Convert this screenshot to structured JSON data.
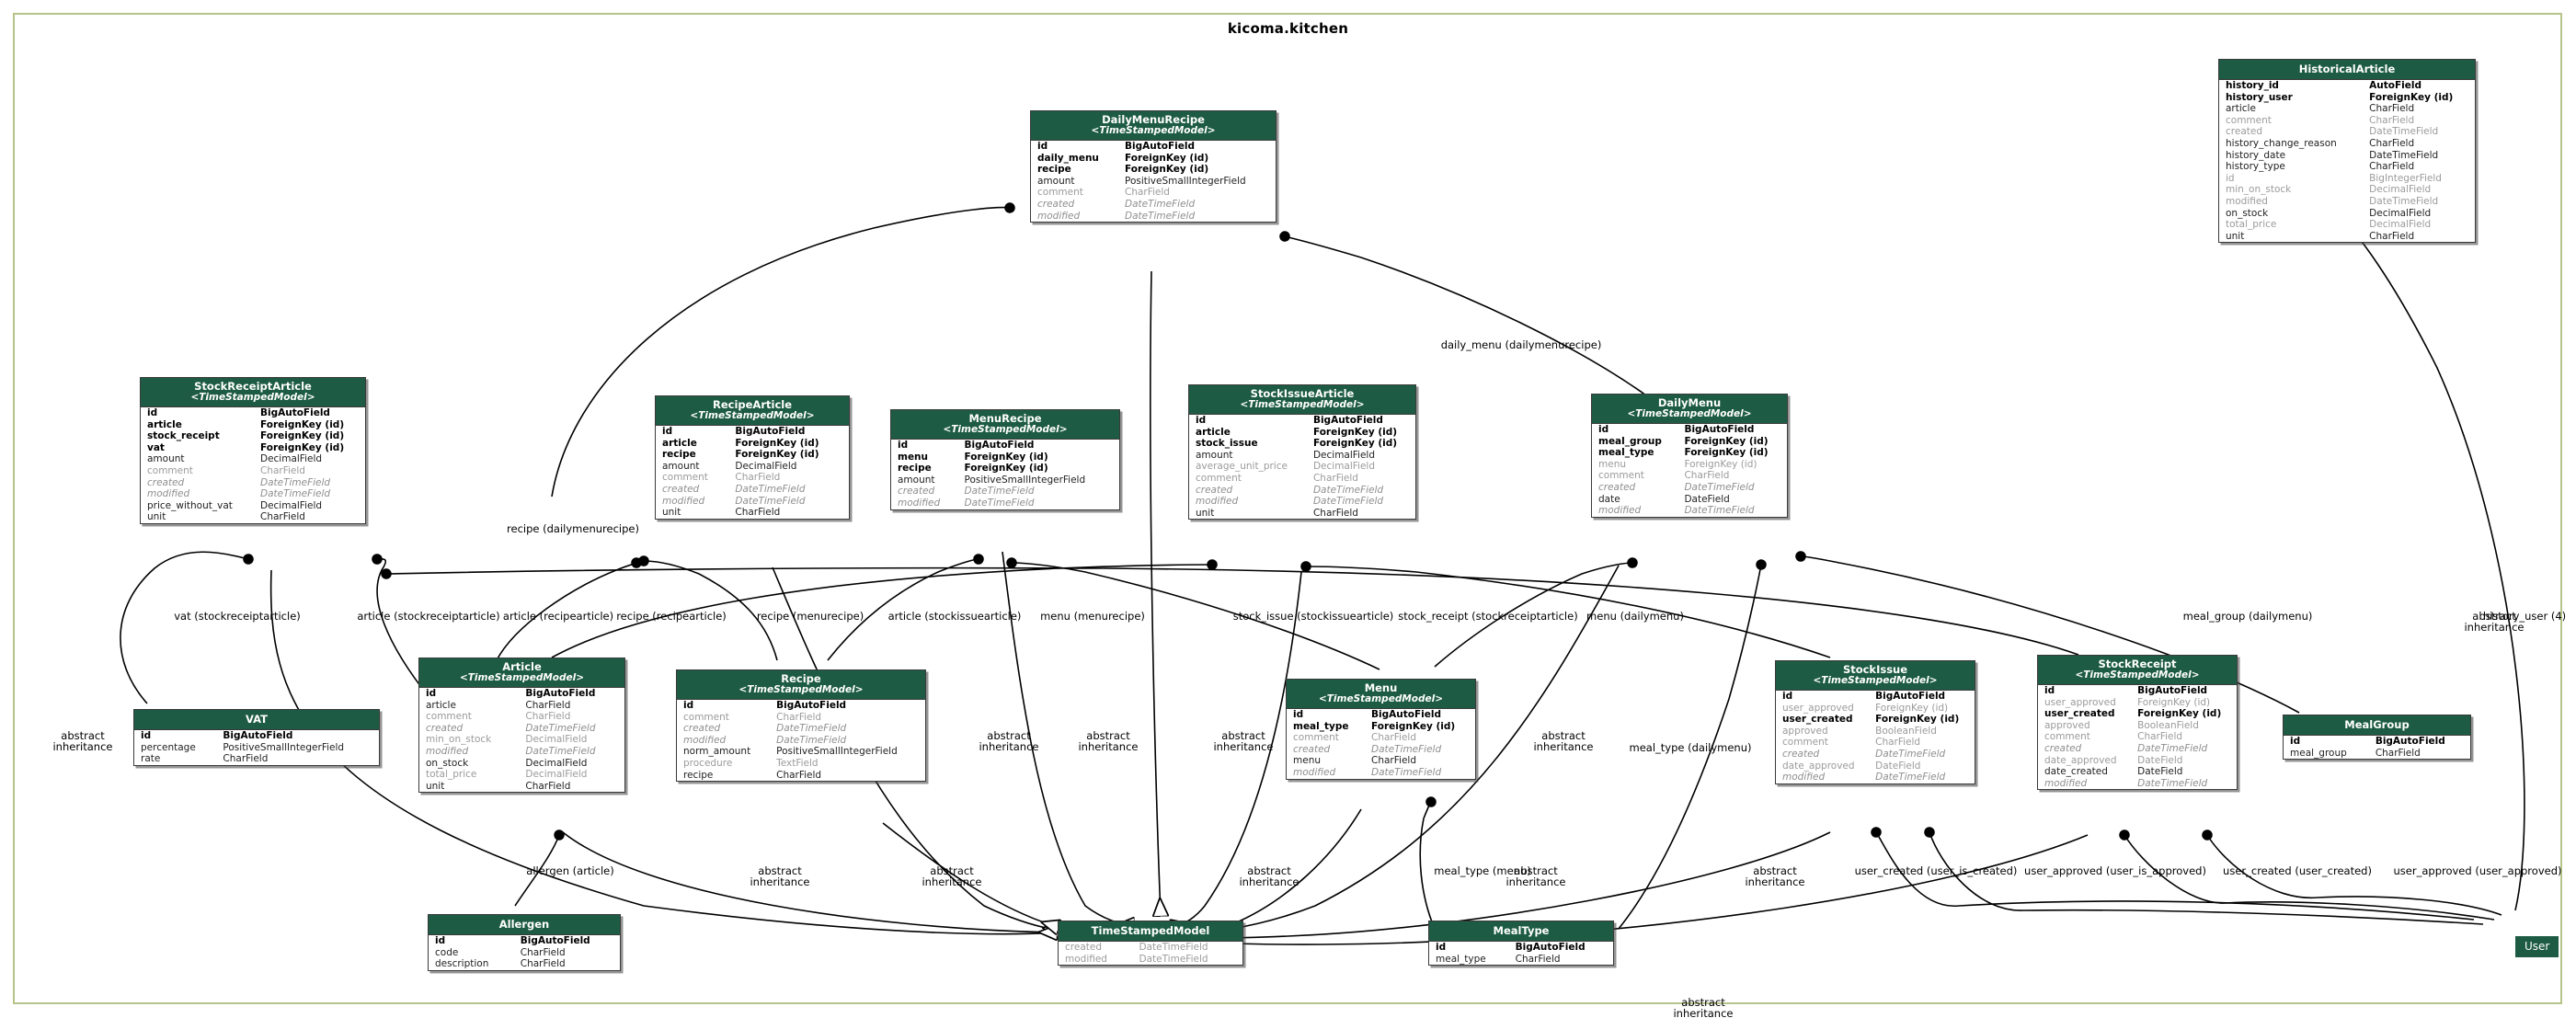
{
  "diagram": {
    "title": "kicoma.kitchen",
    "type": "django-model-erd",
    "header_color": "#1d5b44",
    "border_color": "#b6c48a",
    "edge_color": "#000000"
  },
  "models": [
    {
      "id": "historicalarticle",
      "name": "HistoricalArticle",
      "base": "",
      "fields": [
        {
          "name": "history_id",
          "type": "AutoField",
          "style": "rel"
        },
        {
          "name": "history_user",
          "type": "ForeignKey (id)",
          "style": "rel"
        },
        {
          "name": "article",
          "type": "CharField",
          "style": "plain"
        },
        {
          "name": "comment",
          "type": "CharField",
          "style": "dim"
        },
        {
          "name": "created",
          "type": "DateTimeField",
          "style": "dim"
        },
        {
          "name": "history_change_reason",
          "type": "CharField",
          "style": "plain"
        },
        {
          "name": "history_date",
          "type": "DateTimeField",
          "style": "plain"
        },
        {
          "name": "history_type",
          "type": "CharField",
          "style": "plain"
        },
        {
          "name": "id",
          "type": "BigIntegerField",
          "style": "dim"
        },
        {
          "name": "min_on_stock",
          "type": "DecimalField",
          "style": "dim"
        },
        {
          "name": "modified",
          "type": "DateTimeField",
          "style": "dim"
        },
        {
          "name": "on_stock",
          "type": "DecimalField",
          "style": "plain"
        },
        {
          "name": "total_price",
          "type": "DecimalField",
          "style": "dim"
        },
        {
          "name": "unit",
          "type": "CharField",
          "style": "plain"
        }
      ]
    },
    {
      "id": "dailymenurecipe",
      "name": "DailyMenuRecipe",
      "base": "<TimeStampedModel>",
      "fields": [
        {
          "name": "id",
          "type": "BigAutoField",
          "style": "rel"
        },
        {
          "name": "daily_menu",
          "type": "ForeignKey (id)",
          "style": "rel"
        },
        {
          "name": "recipe",
          "type": "ForeignKey (id)",
          "style": "rel"
        },
        {
          "name": "amount",
          "type": "PositiveSmallIntegerField",
          "style": "plain"
        },
        {
          "name": "comment",
          "type": "CharField",
          "style": "dim"
        },
        {
          "name": "created",
          "type": "DateTimeField",
          "style": "abs"
        },
        {
          "name": "modified",
          "type": "DateTimeField",
          "style": "abs"
        }
      ]
    },
    {
      "id": "stockreceiptarticle",
      "name": "StockReceiptArticle",
      "base": "<TimeStampedModel>",
      "fields": [
        {
          "name": "id",
          "type": "BigAutoField",
          "style": "rel"
        },
        {
          "name": "article",
          "type": "ForeignKey (id)",
          "style": "rel"
        },
        {
          "name": "stock_receipt",
          "type": "ForeignKey (id)",
          "style": "rel"
        },
        {
          "name": "vat",
          "type": "ForeignKey (id)",
          "style": "rel"
        },
        {
          "name": "amount",
          "type": "DecimalField",
          "style": "plain"
        },
        {
          "name": "comment",
          "type": "CharField",
          "style": "dim"
        },
        {
          "name": "created",
          "type": "DateTimeField",
          "style": "abs"
        },
        {
          "name": "modified",
          "type": "DateTimeField",
          "style": "abs"
        },
        {
          "name": "price_without_vat",
          "type": "DecimalField",
          "style": "plain"
        },
        {
          "name": "unit",
          "type": "CharField",
          "style": "plain"
        }
      ]
    },
    {
      "id": "recipearticle",
      "name": "RecipeArticle",
      "base": "<TimeStampedModel>",
      "fields": [
        {
          "name": "id",
          "type": "BigAutoField",
          "style": "rel"
        },
        {
          "name": "article",
          "type": "ForeignKey (id)",
          "style": "rel"
        },
        {
          "name": "recipe",
          "type": "ForeignKey (id)",
          "style": "rel"
        },
        {
          "name": "amount",
          "type": "DecimalField",
          "style": "plain"
        },
        {
          "name": "comment",
          "type": "CharField",
          "style": "dim"
        },
        {
          "name": "created",
          "type": "DateTimeField",
          "style": "abs"
        },
        {
          "name": "modified",
          "type": "DateTimeField",
          "style": "abs"
        },
        {
          "name": "unit",
          "type": "CharField",
          "style": "plain"
        }
      ]
    },
    {
      "id": "menurecipe",
      "name": "MenuRecipe",
      "base": "<TimeStampedModel>",
      "fields": [
        {
          "name": "id",
          "type": "BigAutoField",
          "style": "rel"
        },
        {
          "name": "menu",
          "type": "ForeignKey (id)",
          "style": "rel"
        },
        {
          "name": "recipe",
          "type": "ForeignKey (id)",
          "style": "rel"
        },
        {
          "name": "amount",
          "type": "PositiveSmallIntegerField",
          "style": "plain"
        },
        {
          "name": "created",
          "type": "DateTimeField",
          "style": "abs"
        },
        {
          "name": "modified",
          "type": "DateTimeField",
          "style": "abs"
        }
      ]
    },
    {
      "id": "stockissuearticle",
      "name": "StockIssueArticle",
      "base": "<TimeStampedModel>",
      "fields": [
        {
          "name": "id",
          "type": "BigAutoField",
          "style": "rel"
        },
        {
          "name": "article",
          "type": "ForeignKey (id)",
          "style": "rel"
        },
        {
          "name": "stock_issue",
          "type": "ForeignKey (id)",
          "style": "rel"
        },
        {
          "name": "amount",
          "type": "DecimalField",
          "style": "plain"
        },
        {
          "name": "average_unit_price",
          "type": "DecimalField",
          "style": "dim"
        },
        {
          "name": "comment",
          "type": "CharField",
          "style": "dim"
        },
        {
          "name": "created",
          "type": "DateTimeField",
          "style": "abs"
        },
        {
          "name": "modified",
          "type": "DateTimeField",
          "style": "abs"
        },
        {
          "name": "unit",
          "type": "CharField",
          "style": "plain"
        }
      ]
    },
    {
      "id": "dailymenu",
      "name": "DailyMenu",
      "base": "<TimeStampedModel>",
      "fields": [
        {
          "name": "id",
          "type": "BigAutoField",
          "style": "rel"
        },
        {
          "name": "meal_group",
          "type": "ForeignKey (id)",
          "style": "rel"
        },
        {
          "name": "meal_type",
          "type": "ForeignKey (id)",
          "style": "rel"
        },
        {
          "name": "menu",
          "type": "ForeignKey (id)",
          "style": "dim"
        },
        {
          "name": "comment",
          "type": "CharField",
          "style": "dim"
        },
        {
          "name": "created",
          "type": "DateTimeField",
          "style": "abs"
        },
        {
          "name": "date",
          "type": "DateField",
          "style": "plain"
        },
        {
          "name": "modified",
          "type": "DateTimeField",
          "style": "abs"
        }
      ]
    },
    {
      "id": "article",
      "name": "Article",
      "base": "<TimeStampedModel>",
      "fields": [
        {
          "name": "id",
          "type": "BigAutoField",
          "style": "rel"
        },
        {
          "name": "article",
          "type": "CharField",
          "style": "plain"
        },
        {
          "name": "comment",
          "type": "CharField",
          "style": "dim"
        },
        {
          "name": "created",
          "type": "DateTimeField",
          "style": "abs"
        },
        {
          "name": "min_on_stock",
          "type": "DecimalField",
          "style": "dim"
        },
        {
          "name": "modified",
          "type": "DateTimeField",
          "style": "abs"
        },
        {
          "name": "on_stock",
          "type": "DecimalField",
          "style": "plain"
        },
        {
          "name": "total_price",
          "type": "DecimalField",
          "style": "dim"
        },
        {
          "name": "unit",
          "type": "CharField",
          "style": "plain"
        }
      ]
    },
    {
      "id": "recipe",
      "name": "Recipe",
      "base": "<TimeStampedModel>",
      "fields": [
        {
          "name": "id",
          "type": "BigAutoField",
          "style": "rel"
        },
        {
          "name": "comment",
          "type": "CharField",
          "style": "dim"
        },
        {
          "name": "created",
          "type": "DateTimeField",
          "style": "abs"
        },
        {
          "name": "modified",
          "type": "DateTimeField",
          "style": "abs"
        },
        {
          "name": "norm_amount",
          "type": "PositiveSmallIntegerField",
          "style": "plain"
        },
        {
          "name": "procedure",
          "type": "TextField",
          "style": "dim"
        },
        {
          "name": "recipe",
          "type": "CharField",
          "style": "plain"
        }
      ]
    },
    {
      "id": "menu",
      "name": "Menu",
      "base": "<TimeStampedModel>",
      "fields": [
        {
          "name": "id",
          "type": "BigAutoField",
          "style": "rel"
        },
        {
          "name": "meal_type",
          "type": "ForeignKey (id)",
          "style": "rel"
        },
        {
          "name": "comment",
          "type": "CharField",
          "style": "dim"
        },
        {
          "name": "created",
          "type": "DateTimeField",
          "style": "abs"
        },
        {
          "name": "menu",
          "type": "CharField",
          "style": "plain"
        },
        {
          "name": "modified",
          "type": "DateTimeField",
          "style": "abs"
        }
      ]
    },
    {
      "id": "stockissue",
      "name": "StockIssue",
      "base": "<TimeStampedModel>",
      "fields": [
        {
          "name": "id",
          "type": "BigAutoField",
          "style": "rel"
        },
        {
          "name": "user_approved",
          "type": "ForeignKey (id)",
          "style": "dim"
        },
        {
          "name": "user_created",
          "type": "ForeignKey (id)",
          "style": "rel"
        },
        {
          "name": "approved",
          "type": "BooleanField",
          "style": "dim"
        },
        {
          "name": "comment",
          "type": "CharField",
          "style": "dim"
        },
        {
          "name": "created",
          "type": "DateTimeField",
          "style": "abs"
        },
        {
          "name": "date_approved",
          "type": "DateField",
          "style": "dim"
        },
        {
          "name": "modified",
          "type": "DateTimeField",
          "style": "abs"
        }
      ]
    },
    {
      "id": "stockreceipt",
      "name": "StockReceipt",
      "base": "<TimeStampedModel>",
      "fields": [
        {
          "name": "id",
          "type": "BigAutoField",
          "style": "rel"
        },
        {
          "name": "user_approved",
          "type": "ForeignKey (id)",
          "style": "dim"
        },
        {
          "name": "user_created",
          "type": "ForeignKey (id)",
          "style": "rel"
        },
        {
          "name": "approved",
          "type": "BooleanField",
          "style": "dim"
        },
        {
          "name": "comment",
          "type": "CharField",
          "style": "dim"
        },
        {
          "name": "created",
          "type": "DateTimeField",
          "style": "abs"
        },
        {
          "name": "date_approved",
          "type": "DateField",
          "style": "dim"
        },
        {
          "name": "date_created",
          "type": "DateField",
          "style": "plain"
        },
        {
          "name": "modified",
          "type": "DateTimeField",
          "style": "abs"
        }
      ]
    },
    {
      "id": "vat",
      "name": "VAT",
      "base": "",
      "fields": [
        {
          "name": "id",
          "type": "BigAutoField",
          "style": "rel"
        },
        {
          "name": "percentage",
          "type": "PositiveSmallIntegerField",
          "style": "plain"
        },
        {
          "name": "rate",
          "type": "CharField",
          "style": "plain"
        }
      ]
    },
    {
      "id": "mealgroup",
      "name": "MealGroup",
      "base": "",
      "fields": [
        {
          "name": "id",
          "type": "BigAutoField",
          "style": "rel"
        },
        {
          "name": "meal_group",
          "type": "CharField",
          "style": "plain"
        }
      ]
    },
    {
      "id": "allergen",
      "name": "Allergen",
      "base": "",
      "fields": [
        {
          "name": "id",
          "type": "BigAutoField",
          "style": "rel"
        },
        {
          "name": "code",
          "type": "CharField",
          "style": "plain"
        },
        {
          "name": "description",
          "type": "CharField",
          "style": "plain"
        }
      ]
    },
    {
      "id": "timestampedmodel",
      "name": "TimeStampedModel",
      "base": "",
      "fields": [
        {
          "name": "created",
          "type": "DateTimeField",
          "style": "dim"
        },
        {
          "name": "modified",
          "type": "DateTimeField",
          "style": "dim"
        }
      ]
    },
    {
      "id": "mealtype",
      "name": "MealType",
      "base": "",
      "fields": [
        {
          "name": "id",
          "type": "BigAutoField",
          "style": "rel"
        },
        {
          "name": "meal_type",
          "type": "CharField",
          "style": "plain"
        }
      ]
    }
  ],
  "user_node": {
    "label": "User"
  },
  "edge_labels": [
    {
      "id": "daily-menu-dailymenurecipe",
      "text": "daily_menu (dailymenurecipe)"
    },
    {
      "id": "recipe-dailymenurecipe",
      "text": "recipe (dailymenurecipe)"
    },
    {
      "id": "vat-stockreceiptarticle",
      "text": "vat (stockreceiptarticle)"
    },
    {
      "id": "article-stockreceiptarticle",
      "text": "article (stockreceiptarticle)"
    },
    {
      "id": "article-recipearticle",
      "text": "article (recipearticle)"
    },
    {
      "id": "recipe-recipearticle",
      "text": "recipe (recipearticle)"
    },
    {
      "id": "recipe-menurecipe",
      "text": "recipe (menurecipe)"
    },
    {
      "id": "article-stockissuearticle",
      "text": "article (stockissuearticle)"
    },
    {
      "id": "menu-menurecipe",
      "text": "menu (menurecipe)"
    },
    {
      "id": "stock-issue-stockissuearticle",
      "text": "stock_issue (stockissuearticle)"
    },
    {
      "id": "stock-receipt-stockreceiptarticle",
      "text": "stock_receipt (stockreceiptarticle)"
    },
    {
      "id": "menu-dailymenu",
      "text": "menu (dailymenu)"
    },
    {
      "id": "meal-group-dailymenu",
      "text": "meal_group (dailymenu)"
    },
    {
      "id": "history-user-4",
      "text": "history_user (4)"
    },
    {
      "id": "meal-type-dailymenu",
      "text": "meal_type (dailymenu)"
    },
    {
      "id": "meal-type-menu",
      "text": "meal_type (menu)"
    },
    {
      "id": "allergen-article",
      "text": "allergen (article)"
    },
    {
      "id": "user-created-user-is-created",
      "text": "user_created (user_is_created)"
    },
    {
      "id": "user-approved-user-is-approved",
      "text": "user_approved (user_is_approved)"
    },
    {
      "id": "user-created-user-created",
      "text": "user_created (user_created)"
    },
    {
      "id": "user-approved-user-approved",
      "text": "user_approved (user_approved)"
    },
    {
      "id": "abstract-inheritance-1",
      "text": "abstract\ninheritance"
    },
    {
      "id": "abstract-inheritance-2",
      "text": "abstract\ninheritance"
    },
    {
      "id": "abstract-inheritance-3",
      "text": "abstract\ninheritance"
    },
    {
      "id": "abstract-inheritance-4",
      "text": "abstract\ninheritance"
    },
    {
      "id": "abstract-inheritance-5",
      "text": "abstract\ninheritance"
    },
    {
      "id": "abstract-inheritance-6",
      "text": "abstract\ninheritance"
    },
    {
      "id": "abstract-inheritance-7",
      "text": "abstract\ninheritance"
    },
    {
      "id": "abstract-inheritance-8",
      "text": "abstract\ninheritance"
    },
    {
      "id": "abstract-inheritance-9",
      "text": "abstract\ninheritance"
    },
    {
      "id": "abstract-inheritance-10",
      "text": "abstract\ninheritance"
    }
  ]
}
